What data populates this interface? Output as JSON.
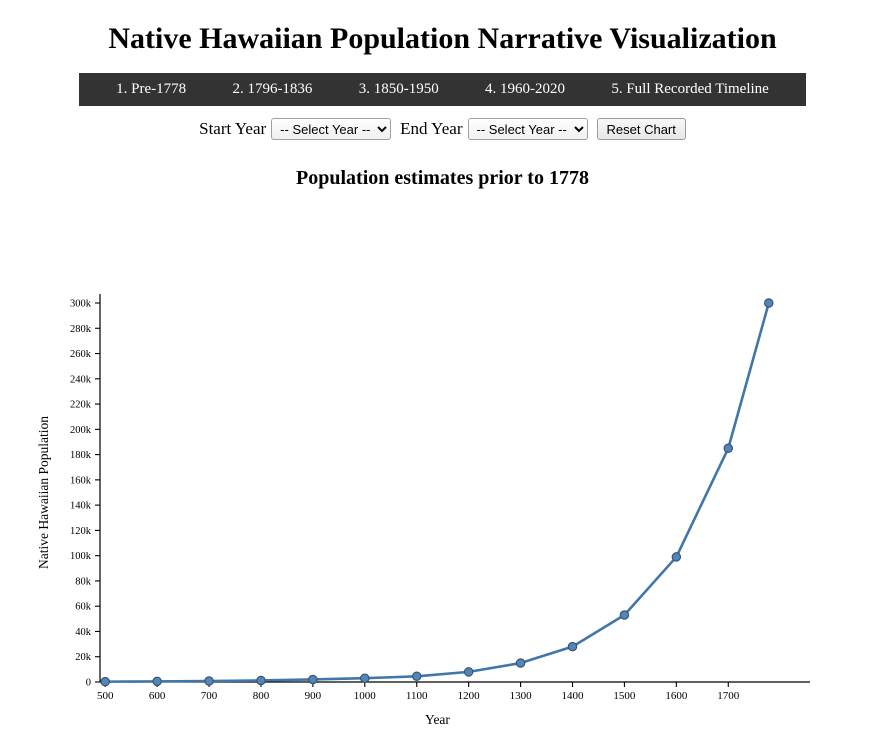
{
  "header": {
    "title": "Native Hawaiian Population Narrative Visualization"
  },
  "navbar": {
    "items": [
      {
        "label": "1. Pre-1778"
      },
      {
        "label": "2. 1796-1836"
      },
      {
        "label": "3. 1850-1950"
      },
      {
        "label": "4. 1960-2020"
      },
      {
        "label": "5. Full Recorded Timeline"
      }
    ],
    "background_color": "#333333",
    "text_color": "#ffffff"
  },
  "controls": {
    "start_year_label": "Start Year",
    "start_year_value": "-- Select Year --",
    "end_year_label": "End Year",
    "end_year_value": "-- Select Year --",
    "reset_label": "Reset Chart"
  },
  "subtitle": "Population estimates prior to 1778",
  "chart_data": {
    "type": "line",
    "title": "Population estimates prior to 1778",
    "xlabel": "Year",
    "ylabel": "Native Hawaiian Population",
    "xlim": [
      490,
      1790
    ],
    "ylim": [
      0,
      300000
    ],
    "grid": false,
    "legend": "none",
    "line_color": "#4076a8",
    "marker_color": "#4e86bd",
    "marker_edge_color": "#3b4f63",
    "xticks": [
      500,
      600,
      700,
      800,
      900,
      1000,
      1100,
      1200,
      1300,
      1400,
      1500,
      1600,
      1700
    ],
    "xtick_labels": [
      "500",
      "600",
      "700",
      "800",
      "900",
      "1000",
      "1100",
      "1200",
      "1300",
      "1400",
      "1500",
      "1600",
      "1700"
    ],
    "yticks": [
      0,
      20000,
      40000,
      60000,
      80000,
      100000,
      120000,
      140000,
      160000,
      180000,
      200000,
      220000,
      240000,
      260000,
      280000,
      300000
    ],
    "ytick_labels": [
      "0",
      "20k",
      "40k",
      "60k",
      "80k",
      "100k",
      "120k",
      "140k",
      "160k",
      "180k",
      "200k",
      "220k",
      "240k",
      "260k",
      "280k",
      "300k"
    ],
    "x": [
      500,
      600,
      700,
      800,
      900,
      1000,
      1100,
      1200,
      1300,
      1400,
      1500,
      1600,
      1700,
      1778
    ],
    "values": [
      300,
      500,
      800,
      1200,
      2000,
      3000,
      4500,
      8000,
      15000,
      28000,
      53000,
      99000,
      185000,
      300000
    ],
    "series": [
      {
        "name": "Native Hawaiian Population",
        "values": [
          300,
          500,
          800,
          1200,
          2000,
          3000,
          4500,
          8000,
          15000,
          28000,
          53000,
          99000,
          185000,
          300000
        ]
      }
    ]
  }
}
